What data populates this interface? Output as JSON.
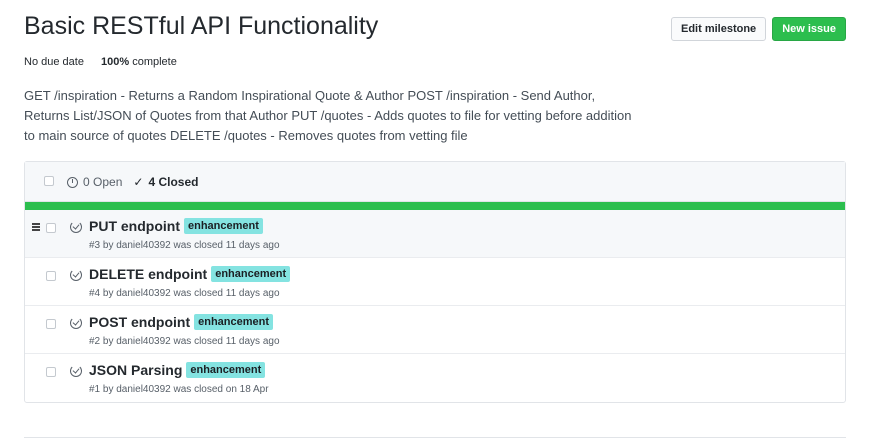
{
  "milestone": {
    "title": "Basic RESTful API Functionality",
    "due": "No due date",
    "percent": "100%",
    "complete_label": "complete",
    "description": "GET /inspiration - Returns a Random Inspirational Quote & Author POST /inspiration - Send Author, Returns List/JSON of Quotes from that Author PUT /quotes - Adds quotes to file for vetting before addition to main source of quotes DELETE /quotes - Removes quotes from vetting file",
    "progress_fraction": 1.0
  },
  "buttons": {
    "edit": "Edit milestone",
    "new_issue": "New issue"
  },
  "states": {
    "open": "0 Open",
    "closed": "4 Closed"
  },
  "colors": {
    "progress": "#2cbe4e",
    "label_enhancement": "#84e3e1",
    "primary_button": "#2cbe4e"
  },
  "issues": [
    {
      "title": "PUT endpoint",
      "label": "enhancement",
      "meta": "#3 by daniel40392 was closed 11 days ago"
    },
    {
      "title": "DELETE endpoint",
      "label": "enhancement",
      "meta": "#4 by daniel40392 was closed 11 days ago"
    },
    {
      "title": "POST endpoint",
      "label": "enhancement",
      "meta": "#2 by daniel40392 was closed 11 days ago"
    },
    {
      "title": "JSON Parsing",
      "label": "enhancement",
      "meta": "#1 by daniel40392 was closed on 18 Apr"
    }
  ]
}
